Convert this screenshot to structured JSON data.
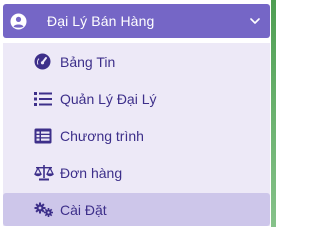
{
  "menu": {
    "header": {
      "label": "Đại Lý Bán Hàng",
      "icon": "user-circle-icon",
      "chevron": "chevron-down-icon"
    },
    "items": [
      {
        "label": "Bảng Tin",
        "icon": "dashboard-gauge-icon"
      },
      {
        "label": "Quản Lý Đại Lý",
        "icon": "list-icon"
      },
      {
        "label": "Chương trình",
        "icon": "table-list-icon"
      },
      {
        "label": "Đơn hàng",
        "icon": "scale-balance-icon"
      },
      {
        "label": "Cài Đặt",
        "icon": "cogs-icon",
        "active": true
      }
    ]
  },
  "colors": {
    "header_bg": "#7566c6",
    "submenu_bg": "#ede9f7",
    "active_bg": "#cdc6ea",
    "item_text": "#3d2f8a"
  }
}
